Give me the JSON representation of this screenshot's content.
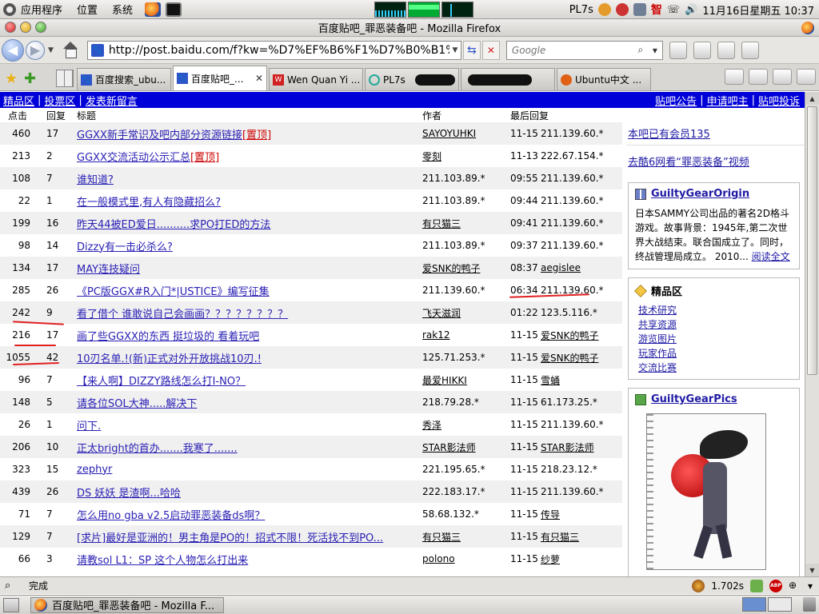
{
  "panel": {
    "applications": "应用程序",
    "places": "位置",
    "system": "系统",
    "user": "PL7s",
    "clock": "11月16日星期五 10:37",
    "tray_zhi": "智"
  },
  "window": {
    "title": "百度贴吧_罪恶装备吧 - Mozilla Firefox"
  },
  "navbar": {
    "url": "http://post.baidu.com/f?kw=%D7%EF%B6%F1%D7%B0%B1%B8",
    "search_placeholder": "Google"
  },
  "tabs": [
    {
      "label": "百度搜索_ubu...",
      "icon": "baidu-icon"
    },
    {
      "label": "百度贴吧_...",
      "icon": "baidu-icon",
      "active": true
    },
    {
      "label": "Wen Quan Yi ...",
      "icon": "wqy-icon"
    },
    {
      "label": "PL7s",
      "icon": "pl-icon"
    },
    {
      "label": "",
      "icon": "blank"
    },
    {
      "label": "Ubuntu中文 ...",
      "icon": "ubuntu-icon"
    }
  ],
  "bluebar": {
    "left": [
      "精品区",
      "投票区",
      "发表新留言"
    ],
    "right": [
      "贴吧公告",
      "申请吧主",
      "贴吧投诉"
    ]
  },
  "table": {
    "headers": {
      "click": "点击",
      "reply": "回复",
      "title": "标题",
      "author": "作者",
      "last": "最后回复"
    },
    "rows": [
      {
        "click": "460",
        "reply": "17",
        "title": "GGXX新手常识及吧内部分资源链接",
        "top": "置顶",
        "author": "SAYOYUHKI",
        "time": "11-15",
        "last_user": "211.139.60.*"
      },
      {
        "click": "213",
        "reply": "2",
        "title": "GGXX交流活动公示汇总",
        "top": "置顶",
        "author": "零刻",
        "time": "11-13",
        "last_user": "222.67.154.*"
      },
      {
        "click": "108",
        "reply": "7",
        "title": "谁知道?",
        "author": "211.103.89.*",
        "time": "09:55",
        "last_user": "211.139.60.*"
      },
      {
        "click": "22",
        "reply": "1",
        "title": "在一般模式里,有人有隐藏招么?",
        "author": "211.103.89.*",
        "time": "09:44",
        "last_user": "211.139.60.*"
      },
      {
        "click": "199",
        "reply": "16",
        "title": "昨天44被ED爱日..........求PO打ED的方法",
        "author": "有只猫三",
        "time": "09:41",
        "last_user": "211.139.60.*"
      },
      {
        "click": "98",
        "reply": "14",
        "title": "Dizzy有一击必杀么?",
        "author": "211.103.89.*",
        "time": "09:37",
        "last_user": "211.139.60.*"
      },
      {
        "click": "134",
        "reply": "17",
        "title": "MAY连技疑问",
        "author": "爱SNK的鸭子",
        "time": "08:37",
        "last_user": "aegislee"
      },
      {
        "click": "285",
        "reply": "26",
        "title": "《PC版GGX#R入门*|USTICE》编写征集",
        "author": "211.139.60.*",
        "time": "06:34",
        "last_user": "211.139.60.*"
      },
      {
        "click": "242",
        "reply": "9",
        "title": "看了借个 谁敢说自己会画画？？？？？？？？",
        "author": "飞天滋润",
        "time": "01:22",
        "last_user": "123.5.116.*"
      },
      {
        "click": "216",
        "reply": "17",
        "title": "画了些GGXX的东西 挺垃圾的 看着玩吧",
        "author": "rak12",
        "time": "11-15",
        "last_user": "爱SNK的鸭子"
      },
      {
        "click": "1055",
        "reply": "42",
        "title": "10刃名单.!(新)正式对外开放挑战10刃.!",
        "author": "125.71.253.*",
        "time": "11-15",
        "last_user": "爱SNK的鸭子"
      },
      {
        "click": "96",
        "reply": "7",
        "title": "【来人啊】DIZZY路线怎么打I-NO？",
        "author": "最爱HIKKI",
        "time": "11-15",
        "last_user": "雪蛹"
      },
      {
        "click": "148",
        "reply": "5",
        "title": "请各位SOL大神.....解决下",
        "author": "218.79.28.*",
        "time": "11-15",
        "last_user": "61.173.25.*"
      },
      {
        "click": "26",
        "reply": "1",
        "title": "问下.",
        "author": "秀泽",
        "time": "11-15",
        "last_user": "211.139.60.*"
      },
      {
        "click": "206",
        "reply": "10",
        "title": "正太bright的首办.......我寒了.......",
        "author": "STAR影法师",
        "time": "11-15",
        "last_user": "STAR影法师"
      },
      {
        "click": "323",
        "reply": "15",
        "title": "zephyr",
        "author": "221.195.65.*",
        "time": "11-15",
        "last_user": "218.23.12.*"
      },
      {
        "click": "439",
        "reply": "26",
        "title": "DS 妖妖 是渣啊...哈哈",
        "author": "222.183.17.*",
        "time": "11-15",
        "last_user": "211.139.60.*"
      },
      {
        "click": "71",
        "reply": "7",
        "title": "怎么用no gba v2.5启动罪恶装备ds啊？",
        "author": "58.68.132.*",
        "time": "11-15",
        "last_user": "传导"
      },
      {
        "click": "129",
        "reply": "7",
        "title": "[求片]最好是亚洲的！男主角是PO的！招式不限！死活找不到PO...",
        "author": "有只猫三",
        "time": "11-15",
        "last_user": "有只猫三"
      },
      {
        "click": "66",
        "reply": "3",
        "title": "请教sol L1：SP 这个人物怎么打出来",
        "author": "polono",
        "time": "11-15",
        "last_user": "纱萝"
      }
    ]
  },
  "sidebar": {
    "members": "本吧已有会员135",
    "video": "去酷6网看“罪恶装备”视频",
    "origin": {
      "title": "GuiltyGearOrigin",
      "text": "日本SAMMY公司出品的著名2D格斗游戏。故事背景：1945年,第二次世界大战结束。联合国成立了。同时，终战管理局成立。 2010...",
      "more": "阅读全文"
    },
    "jing": {
      "title": "精品区",
      "items": [
        "技术研究",
        "共享资源",
        "游览图片",
        "玩家作品",
        "交流比赛"
      ]
    },
    "pics": {
      "title": "GuiltyGearPics"
    }
  },
  "status": {
    "text": "完成",
    "timing": "1.702s"
  },
  "taskbar": {
    "task_label": "百度贴吧_罪恶装备吧 - Mozilla F..."
  }
}
